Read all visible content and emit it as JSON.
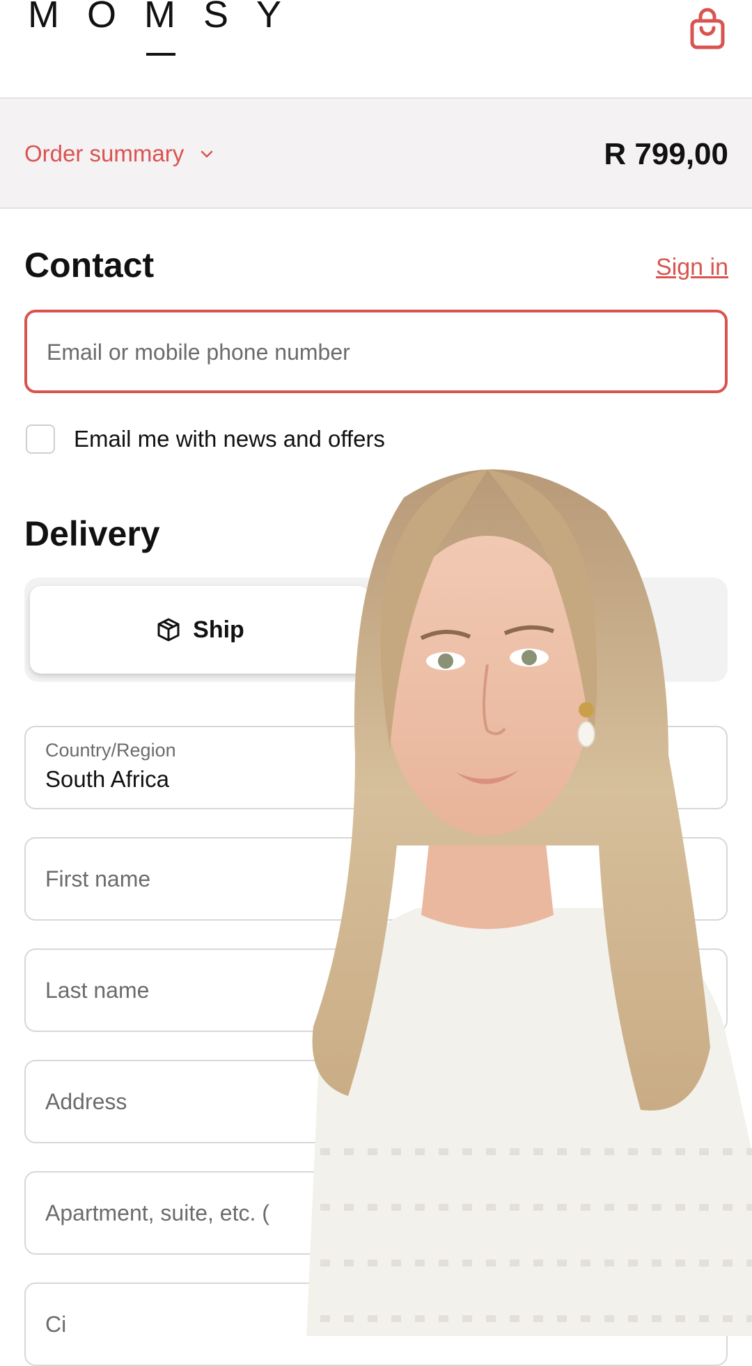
{
  "header": {
    "logo": "MOMSY",
    "cart_icon": "shopping-bag-icon",
    "accent_color": "#d9534f"
  },
  "order_summary": {
    "label": "Order summary",
    "toggle_icon": "chevron-down-icon",
    "total": "R 799,00"
  },
  "contact": {
    "title": "Contact",
    "sign_in": "Sign in",
    "email_placeholder": "Email or mobile phone number",
    "newsletter_label": "Email me with news and offers",
    "newsletter_checked": false
  },
  "delivery": {
    "title": "Delivery",
    "ship_tab": "Ship",
    "ship_icon": "package-icon",
    "country_label": "Country/Region",
    "country_value": "South Africa",
    "first_name_placeholder": "First name",
    "last_name_placeholder": "Last name",
    "address_placeholder": "Address",
    "apartment_placeholder": "Apartment, suite, etc. (",
    "city_placeholder": "Ci"
  }
}
